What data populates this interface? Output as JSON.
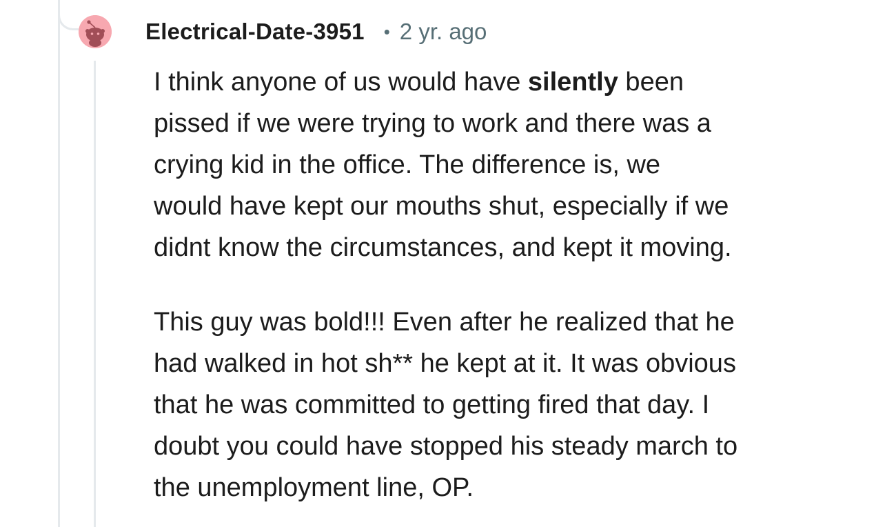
{
  "comment": {
    "author": "Electrical-Date-3951",
    "separator": "•",
    "timestamp": "2 yr. ago",
    "avatar_icon": "snoo-avatar-icon",
    "avatar_color": "#f7a8b0",
    "paragraphs": [
      {
        "lines": [
          {
            "pre": "I think anyone of us would have ",
            "bold": "silently",
            "post": " been"
          },
          {
            "text": "pissed if we were trying to work and there was a"
          },
          {
            "text": "crying kid in the office. The difference is, we"
          },
          {
            "text": "would have kept our mouths shut, especially if we"
          },
          {
            "text": "didnt know the circumstances, and kept it moving."
          }
        ]
      },
      {
        "lines": [
          {
            "text": "This guy was bold!!! Even after he realized that he"
          },
          {
            "text": "had walked in hot sh** he kept at it. It was obvious"
          },
          {
            "text": "that he was committed to getting fired that day. I"
          },
          {
            "text": "doubt you could have stopped his steady march to"
          },
          {
            "text": "the unemployment line, OP."
          }
        ]
      }
    ]
  },
  "colors": {
    "text": "#1c1c1c",
    "meta": "#576f76",
    "thread_line": "#e5e9ec"
  }
}
